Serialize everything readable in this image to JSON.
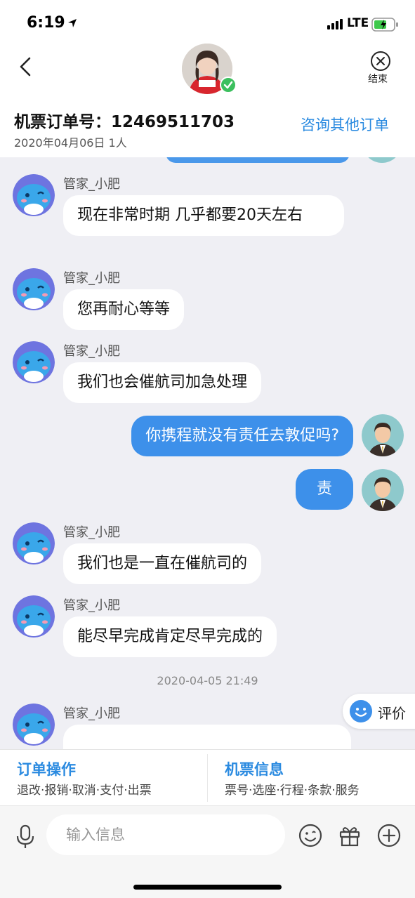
{
  "status_bar": {
    "time": "6:19",
    "network": "LTE"
  },
  "header": {
    "end_label": "结束",
    "order_title": "机票订单号：12469511703",
    "order_sub": "2020年04月06日 1人",
    "other_orders_label": "咨询其他订单"
  },
  "chat": {
    "messages": [
      {
        "sender": "agent",
        "name": "管家_小肥",
        "text": "现在非常时期  几乎都要20天左右"
      },
      {
        "sender": "agent",
        "name": "管家_小肥",
        "text": "您再耐心等等"
      },
      {
        "sender": "agent",
        "name": "管家_小肥",
        "text": "我们也会催航司加急处理"
      },
      {
        "sender": "user",
        "text": "你携程就没有责任去敦促吗?"
      },
      {
        "sender": "user",
        "text": "责"
      },
      {
        "sender": "agent",
        "name": "管家_小肥",
        "text": "我们也是一直在催航司的"
      },
      {
        "sender": "agent",
        "name": "管家_小肥",
        "text": "能尽早完成肯定尽早完成的"
      },
      {
        "sender": "agent",
        "name": "管家_小肥",
        "text": ""
      }
    ],
    "timestamp": "2020-04-05  21:49",
    "rate_label": "评价"
  },
  "order_bar": {
    "left_title": "订单操作",
    "left_sub": "退改·报销·取消·支付·出票",
    "right_title": "机票信息",
    "right_sub": "票号·选座·行程·条款·服务"
  },
  "input_bar": {
    "placeholder": "输入信息"
  },
  "colors": {
    "accent": "#2a8ae0",
    "user_bubble": "#3d90ea",
    "chat_bg": "#efeff4"
  },
  "icons": [
    "back-chevron-icon",
    "close-circle-icon",
    "microphone-icon",
    "emoji-icon",
    "gift-icon",
    "plus-circle-icon",
    "smile-icon",
    "location-arrow-icon",
    "signal-icon",
    "battery-icon"
  ]
}
